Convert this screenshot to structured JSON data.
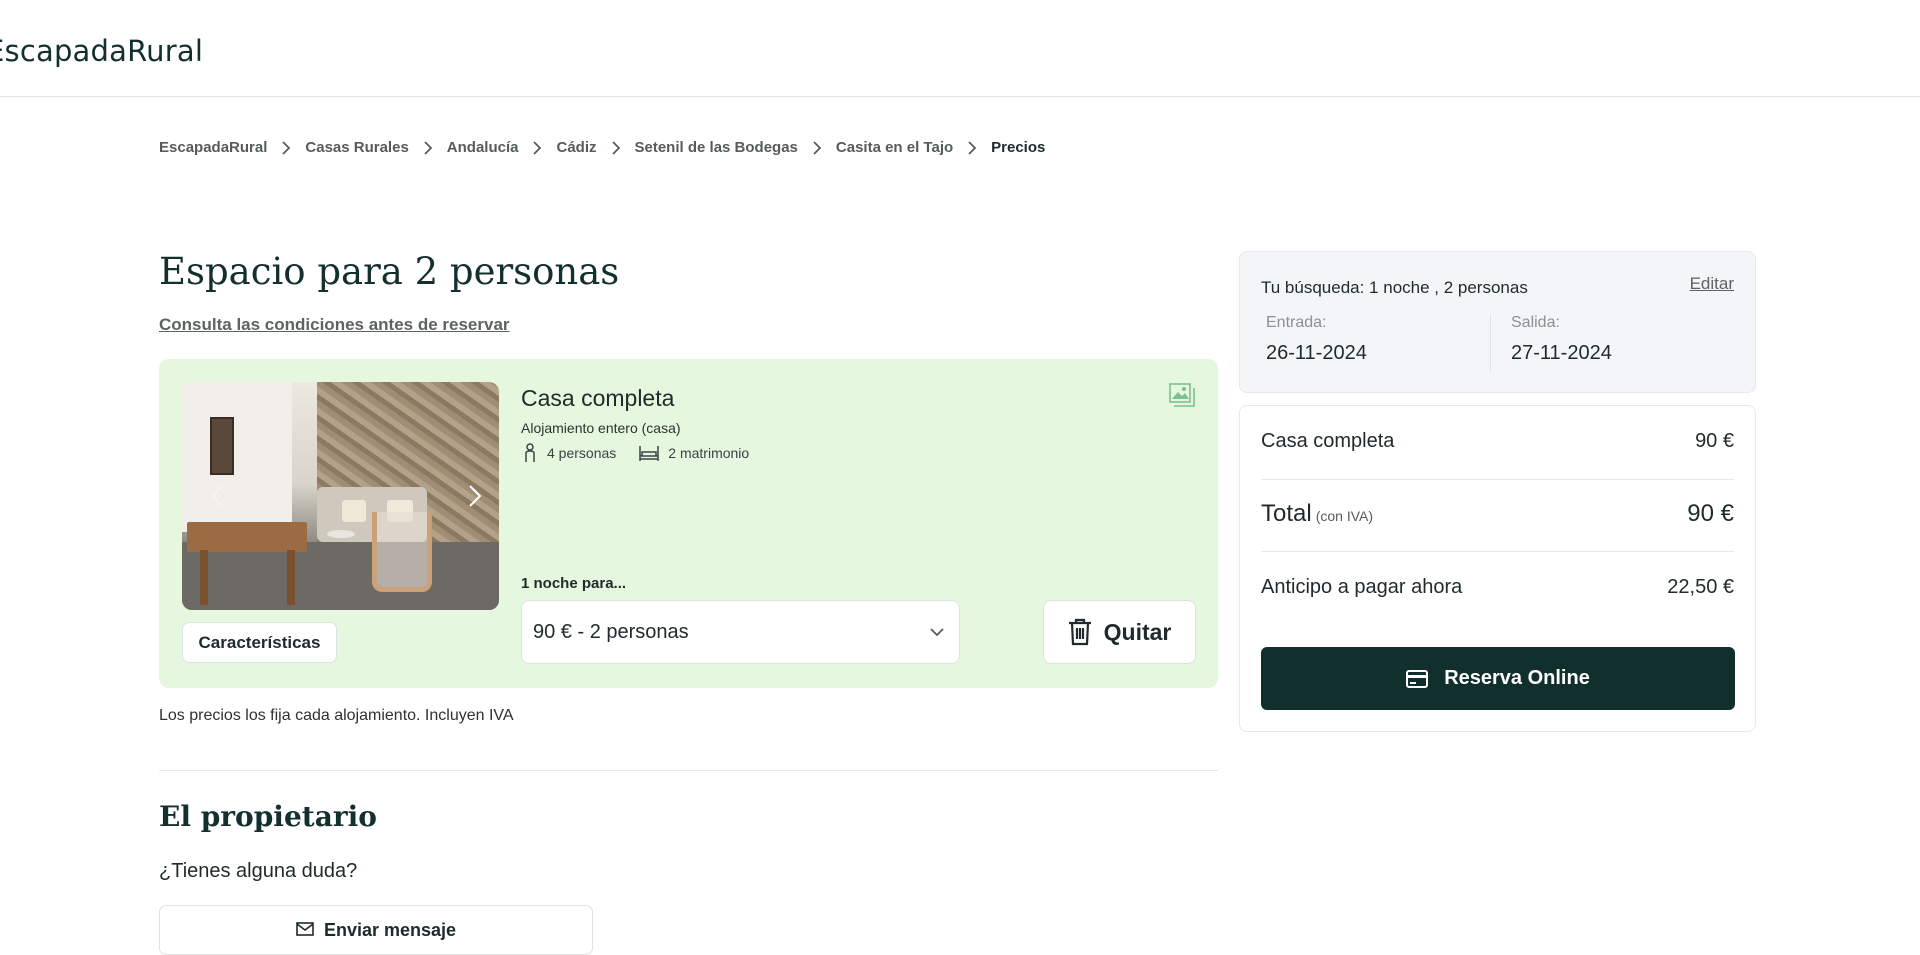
{
  "header": {
    "logo": "EscapadaRural"
  },
  "breadcrumb": [
    {
      "label": "EscapadaRural"
    },
    {
      "label": "Casas Rurales"
    },
    {
      "label": "Andalucía"
    },
    {
      "label": "Cádiz"
    },
    {
      "label": "Setenil de las Bodegas"
    },
    {
      "label": "Casita en el Tajo"
    },
    {
      "label": "Precios"
    }
  ],
  "main": {
    "title": "Espacio para 2 personas",
    "conditions_link": "Consulta las condiciones antes de reservar",
    "unit": {
      "title": "Casa completa",
      "subtitle": "Alojamiento entero (casa)",
      "guests": "4 personas",
      "beds": "2 matrimonio",
      "features_button": "Características",
      "nights_label": "1 noche para...",
      "selected_option": "90 € - 2 personas",
      "remove_button": "Quitar"
    },
    "price_note": "Los precios los fija cada alojamiento. Incluyen IVA",
    "owner": {
      "title": "El propietario",
      "question": "¿Tienes alguna duda?",
      "message_button": "Enviar mensaje"
    }
  },
  "search": {
    "summary": "Tu búsqueda: 1 noche , 2 personas",
    "edit": "Editar",
    "checkin_label": "Entrada:",
    "checkin_value": "26-11-2024",
    "checkout_label": "Salida:",
    "checkout_value": "27-11-2024"
  },
  "summary": {
    "line_label": "Casa completa",
    "line_value": "90 €",
    "total_label": "Total",
    "total_note": "(con IVA)",
    "total_value": "90 €",
    "deposit_label": "Anticipo a pagar ahora",
    "deposit_value": "22,50 €",
    "book_button": "Reserva Online"
  },
  "colors": {
    "brand_dark": "#11302d",
    "card_bg": "#e6f7df",
    "search_bg": "#f3f5f7"
  },
  "icons": [
    "chevron-right-icon",
    "gallery-icon",
    "person-icon",
    "bed-icon",
    "chevron-down-icon",
    "trash-icon",
    "credit-card-icon",
    "mail-icon"
  ]
}
